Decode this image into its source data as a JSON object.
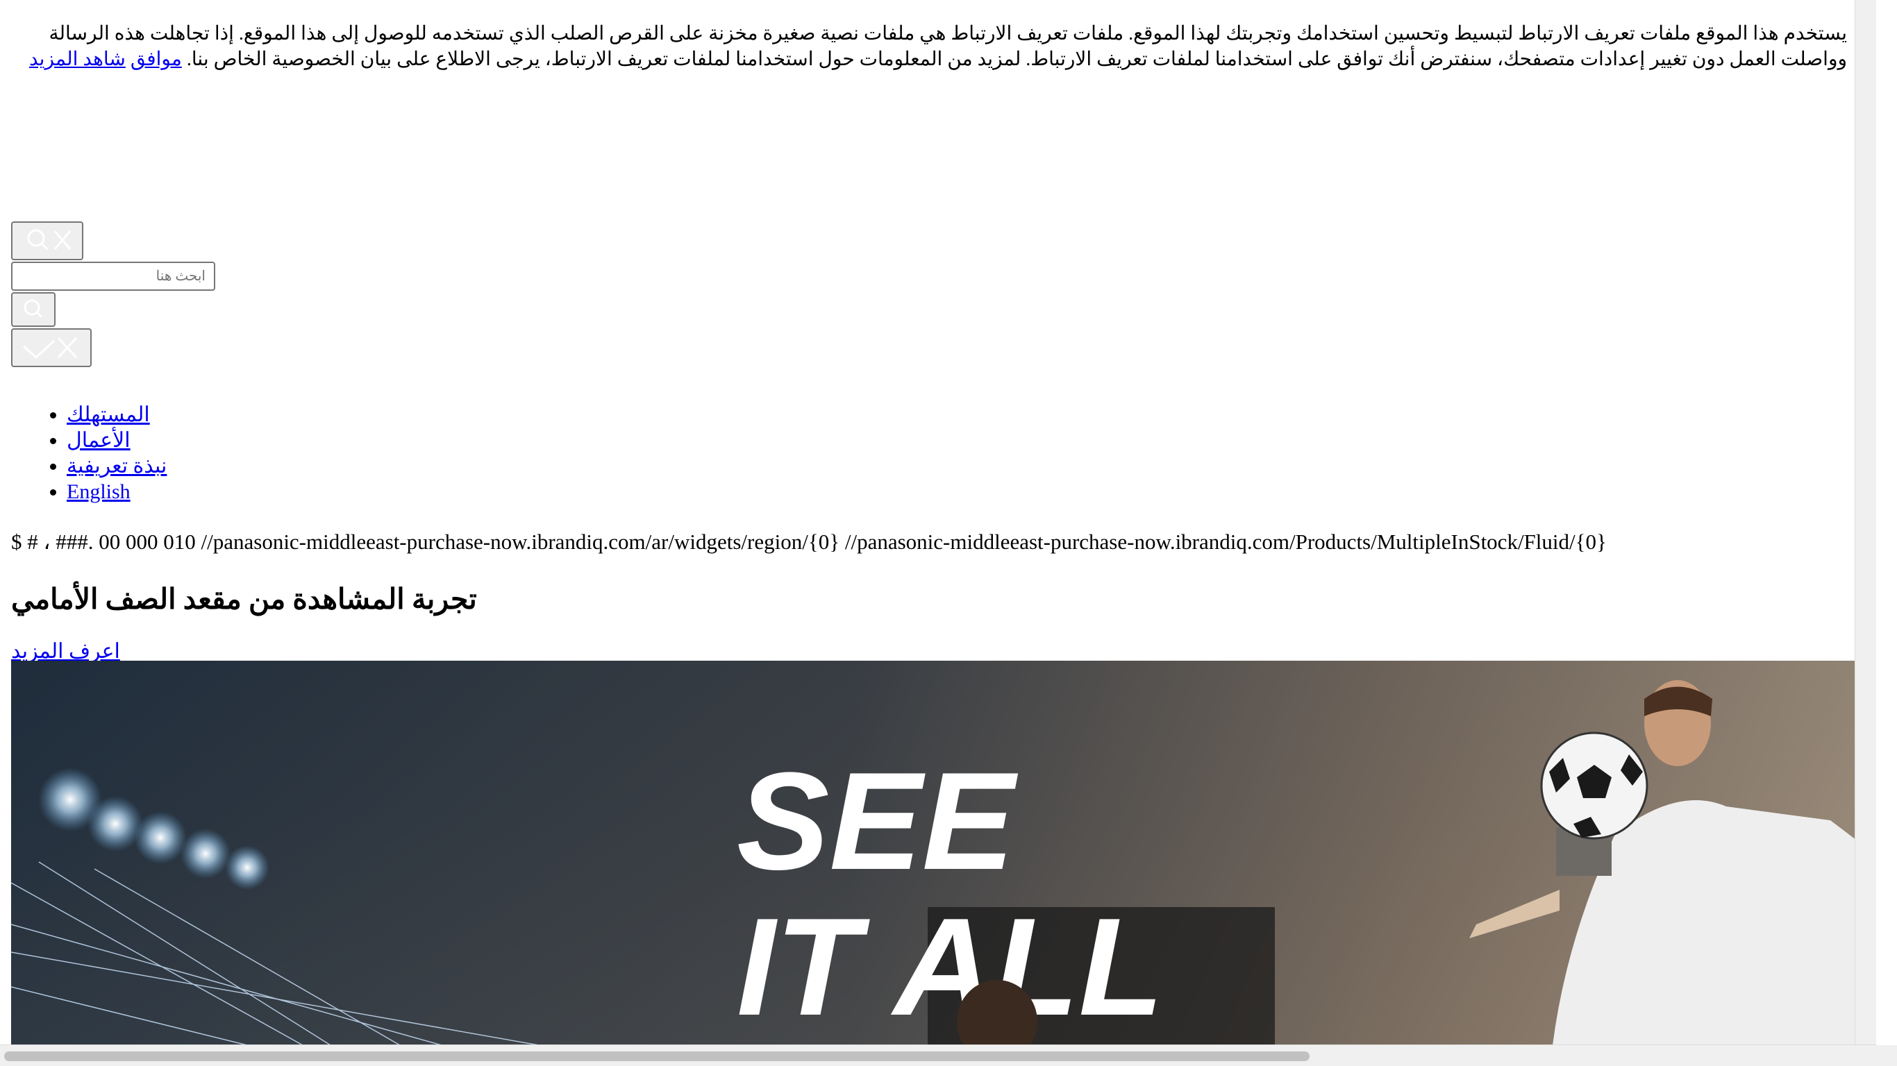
{
  "cookie_banner": {
    "message": "يستخدم هذا الموقع ملفات تعريف الارتباط لتبسيط وتحسين استخدامك وتجربتك لهذا الموقع. ملفات تعريف الارتباط هي ملفات نصية صغيرة مخزنة على القرص الصلب الذي تستخدمه للوصول إلى هذا الموقع. إذا تجاهلت هذه الرسالة وواصلت العمل دون تغيير إعدادات متصفحك، سنفترض أنك توافق على استخدامنا لملفات تعريف الارتباط. لمزيد من المعلومات حول استخدامنا لملفات تعريف الارتباط، يرجى الاطلاع على بيان الخصوصية الخاص بنا.",
    "accept_label": "موافق",
    "more_label": "شاهد المزيد"
  },
  "search": {
    "placeholder": "ابحث هنا"
  },
  "nav": {
    "items": [
      {
        "label": "المستهلك"
      },
      {
        "label": "الأعمال"
      },
      {
        "label": "نبذة تعريفية"
      },
      {
        "label": "English"
      }
    ]
  },
  "config_text": "$ # ، ###. 00 000 010 //panasonic-middleeast-purchase-now.ibrandiq.com/ar/widgets/region/{0} //panasonic-middleeast-purchase-now.ibrandiq.com/Products/MultipleInStock/Fluid/{0}",
  "hero": {
    "title": "تجربة المشاهدة من مقعد الصف الأمامي",
    "learn_more": "اعرف المزيد",
    "banner_line1": "SEE",
    "banner_line2": "IT ALL"
  },
  "colors": {
    "link": "#0000ee",
    "banner_sky": "#26303b"
  }
}
